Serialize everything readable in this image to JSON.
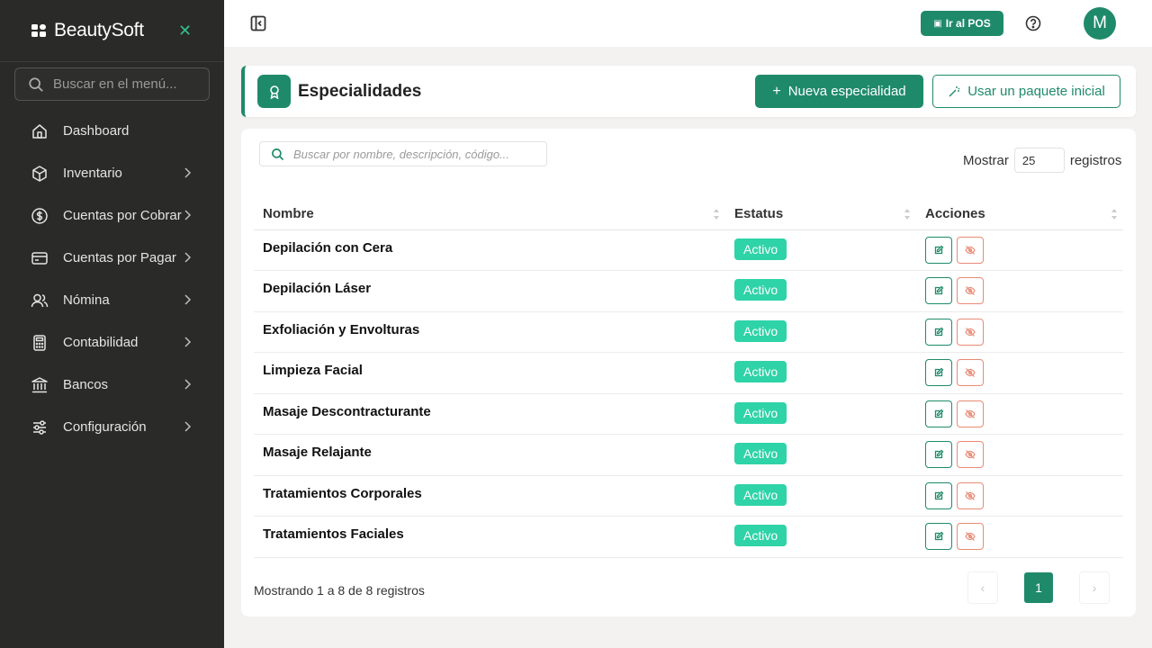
{
  "brand": {
    "name": "BeautySoft"
  },
  "sidebar": {
    "search_placeholder": "Buscar en el menú...",
    "items": [
      {
        "label": "Dashboard",
        "icon": "home-icon",
        "has_submenu": false
      },
      {
        "label": "Inventario",
        "icon": "box-icon",
        "has_submenu": true
      },
      {
        "label": "Cuentas por Cobrar",
        "icon": "dollar-circle-icon",
        "has_submenu": true
      },
      {
        "label": "Cuentas por Pagar",
        "icon": "credit-card-icon",
        "has_submenu": true
      },
      {
        "label": "Nómina",
        "icon": "users-icon",
        "has_submenu": true
      },
      {
        "label": "Contabilidad",
        "icon": "calculator-icon",
        "has_submenu": true
      },
      {
        "label": "Bancos",
        "icon": "bank-icon",
        "has_submenu": true
      },
      {
        "label": "Configuración",
        "icon": "sliders-icon",
        "has_submenu": true
      }
    ]
  },
  "topbar": {
    "pos_label": "Ir al POS",
    "avatar_initial": "M"
  },
  "header": {
    "title": "Especialidades",
    "new_button": "Nueva especialidad",
    "pack_button": "Usar un paquete inicial"
  },
  "table": {
    "search_placeholder": "Buscar por nombre, descripción, código...",
    "show_label": "Mostrar",
    "show_value": "25",
    "records_label": "registros",
    "columns": [
      "Nombre",
      "Estatus",
      "Acciones"
    ],
    "rows": [
      {
        "name": "Depilación con Cera",
        "status": "Activo"
      },
      {
        "name": "Depilación Láser",
        "status": "Activo"
      },
      {
        "name": "Exfoliación y Envolturas",
        "status": "Activo"
      },
      {
        "name": "Limpieza Facial",
        "status": "Activo"
      },
      {
        "name": "Masaje Descontracturante",
        "status": "Activo"
      },
      {
        "name": "Masaje Relajante",
        "status": "Activo"
      },
      {
        "name": "Tratamientos Corporales",
        "status": "Activo"
      },
      {
        "name": "Tratamientos Faciales",
        "status": "Activo"
      }
    ],
    "footer_info": "Mostrando 1 a 8 de 8 registros",
    "pager": {
      "prev": "‹",
      "current": "1",
      "next": "›"
    }
  },
  "colors": {
    "accent": "#1f8a6a",
    "badge": "#2ed3a7",
    "danger": "#e98a75",
    "sidebar_bg": "#2a2a28"
  }
}
